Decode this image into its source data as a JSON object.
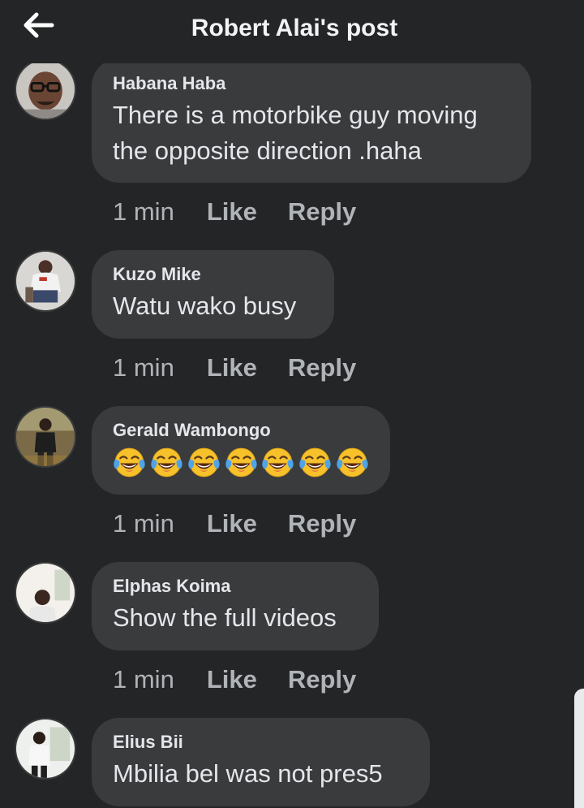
{
  "header": {
    "title": "Robert Alai's post",
    "back_icon": "arrow-left-icon"
  },
  "comments": [
    {
      "author": "Habana Haba",
      "lines": [
        "There is a motorbike guy moving",
        "the opposite direction .haha"
      ],
      "time": "1 min",
      "like": "Like",
      "reply": "Reply"
    },
    {
      "author": "Kuzo Mike",
      "lines": [
        "Watu wako busy"
      ],
      "time": "1 min",
      "like": "Like",
      "reply": "Reply"
    },
    {
      "author": "Gerald Wambongo",
      "emoji": "face-with-tears-of-joy-icon",
      "emoji_count": 7,
      "time": "1 min",
      "like": "Like",
      "reply": "Reply"
    },
    {
      "author": "Elphas Koima",
      "lines": [
        "Show the full videos"
      ],
      "time": "1 min",
      "like": "Like",
      "reply": "Reply"
    },
    {
      "author": "Elius Bii",
      "lines": [
        "Mbilia bel was not pres5"
      ]
    }
  ],
  "colors": {
    "background": "#242526",
    "bubble": "#3a3b3c",
    "primary_text": "#e4e6eb",
    "secondary_text": "#b0b3b8"
  }
}
